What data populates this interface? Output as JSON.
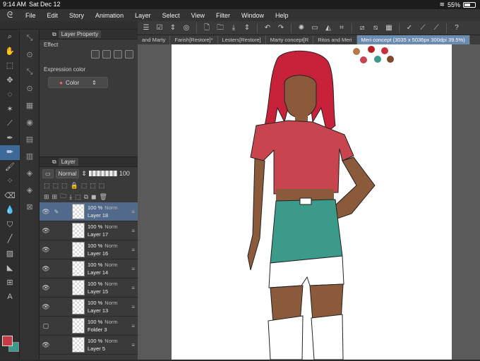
{
  "status_bar": {
    "time": "9:14 AM",
    "date": "Sat Dec 12",
    "battery": "55%",
    "battery_level": 0.55
  },
  "menu": [
    "File",
    "Edit",
    "Story",
    "Animation",
    "Layer",
    "Select",
    "View",
    "Filter",
    "Window",
    "Help"
  ],
  "layer_property": {
    "title": "Layer Property",
    "effect_label": "Effect",
    "expression_label": "Expression color",
    "expression_value": "Color"
  },
  "layer_panel": {
    "title": "Layer",
    "blend_mode": "Normal",
    "opacity": "100",
    "layers": [
      {
        "opacity": "100 %",
        "mode": "Norm",
        "name": "Layer 18",
        "selected": true,
        "visible": true
      },
      {
        "opacity": "100 %",
        "mode": "Norm",
        "name": "Layer 17",
        "selected": false,
        "visible": true
      },
      {
        "opacity": "100 %",
        "mode": "Norm",
        "name": "Layer 16",
        "selected": false,
        "visible": true
      },
      {
        "opacity": "100 %",
        "mode": "Norm",
        "name": "Layer 14",
        "selected": false,
        "visible": true
      },
      {
        "opacity": "100 %",
        "mode": "Norm",
        "name": "Layer 15",
        "selected": false,
        "visible": true
      },
      {
        "opacity": "100 %",
        "mode": "Norm",
        "name": "Layer 13",
        "selected": false,
        "visible": true
      },
      {
        "opacity": "100 %",
        "mode": "Norm",
        "name": "Folder 3",
        "selected": false,
        "visible": false
      },
      {
        "opacity": "100 %",
        "mode": "Norm",
        "name": "Layer 5",
        "selected": false,
        "visible": true
      }
    ]
  },
  "doc_tabs": [
    {
      "label": "and Marty",
      "active": false
    },
    {
      "label": "Farish[Restore]*",
      "active": false
    },
    {
      "label": "Lesters[Restore]",
      "active": false
    },
    {
      "label": "Marty concept[R",
      "active": false
    },
    {
      "label": "Ritos and Meri",
      "active": false
    },
    {
      "label": "Meri concept (3035 x 5036px 300dpi 39.5%)",
      "active": true
    }
  ],
  "colors": {
    "foreground": "#c43b46",
    "background": "#3a9a8c",
    "palette": [
      "#b5784a",
      "#b81f25",
      "#c9303c",
      "#c4474f",
      "#3c9a8a",
      "#7a4a2a"
    ]
  }
}
